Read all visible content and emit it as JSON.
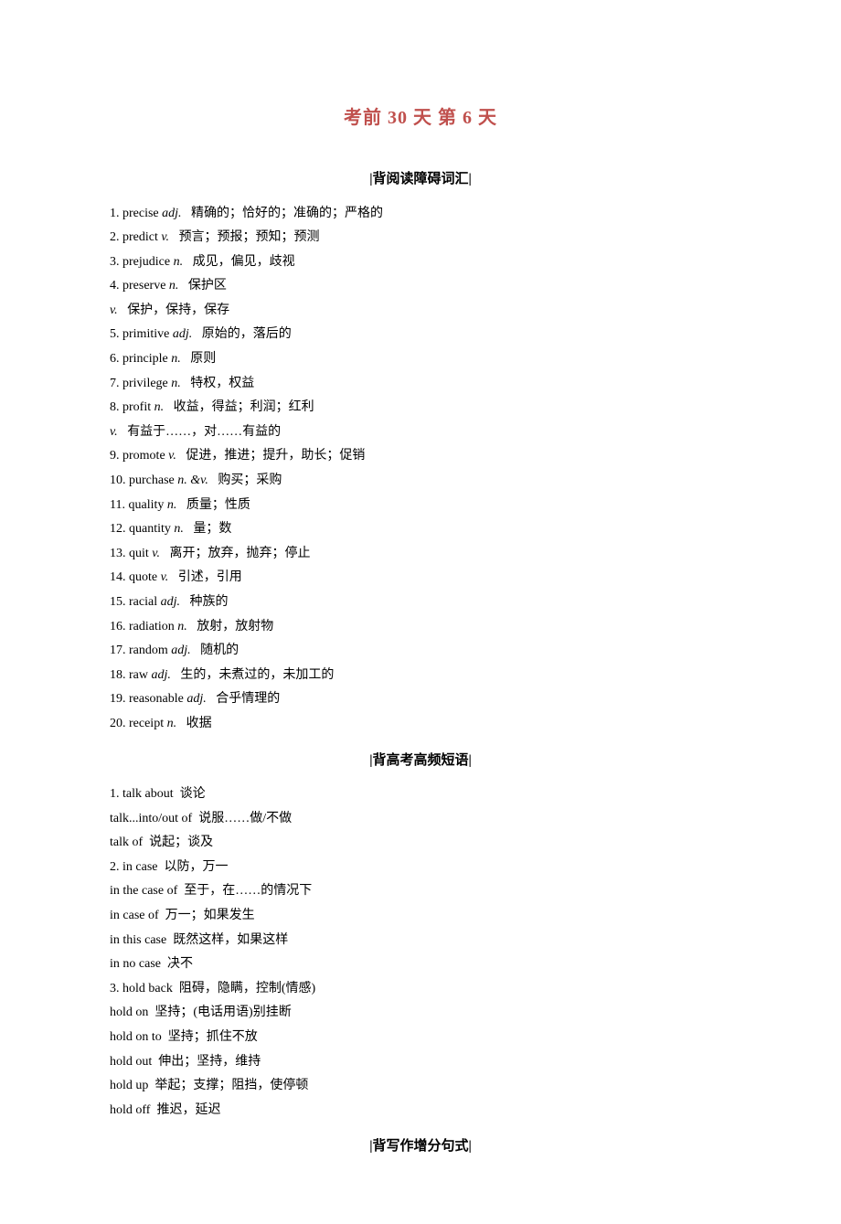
{
  "title": "考前 30 天  第 6 天",
  "sections": {
    "vocab": {
      "heading": "|背阅读障碍词汇|",
      "items": [
        {
          "num": "1.",
          "word": "precise",
          "pos": "adj.",
          "def": "精确的；恰好的；准确的；严格的"
        },
        {
          "num": "2.",
          "word": "predict",
          "pos": "v.",
          "def": "预言；预报；预知；预测"
        },
        {
          "num": "3.",
          "word": "prejudice",
          "pos": "n.",
          "def": "成见，偏见，歧视"
        },
        {
          "num": "4.",
          "word": "preserve",
          "pos": "n.",
          "def": "保护区",
          "extra": [
            {
              "pos": "v.",
              "def": "保护，保持，保存"
            }
          ]
        },
        {
          "num": "5.",
          "word": "primitive",
          "pos": "adj.",
          "def": "原始的，落后的"
        },
        {
          "num": "6.",
          "word": "principle",
          "pos": "n.",
          "def": "原则"
        },
        {
          "num": "7.",
          "word": "privilege",
          "pos": "n.",
          "def": "特权，权益"
        },
        {
          "num": "8.",
          "word": "profit",
          "pos": "n.",
          "def": "收益，得益；利润；红利",
          "extra": [
            {
              "pos": "v.",
              "def": "有益于……，对……有益的"
            }
          ]
        },
        {
          "num": "9.",
          "word": "promote",
          "pos": "v.",
          "def": "促进，推进；提升，助长；促销"
        },
        {
          "num": "10.",
          "word": "purchase",
          "pos": "n. &v.",
          "def": "购买；采购"
        },
        {
          "num": "11.",
          "word": "quality",
          "pos": "n.",
          "def": "质量；性质"
        },
        {
          "num": "12.",
          "word": "quantity",
          "pos": "n.",
          "def": "量；数"
        },
        {
          "num": "13.",
          "word": "quit",
          "pos": "v.",
          "def": "离开；放弃，抛弃；停止"
        },
        {
          "num": "14.",
          "word": "quote",
          "pos": "v.",
          "def": "引述，引用"
        },
        {
          "num": "15.",
          "word": "racial",
          "pos": "adj.",
          "def": "种族的"
        },
        {
          "num": "16.",
          "word": "radiation",
          "pos": "n.",
          "def": "放射，放射物"
        },
        {
          "num": "17.",
          "word": "random",
          "pos": "adj.",
          "def": "随机的"
        },
        {
          "num": "18.",
          "word": "raw",
          "pos": "adj.",
          "def": "生的，未煮过的，未加工的"
        },
        {
          "num": "19.",
          "word": "reasonable",
          "pos": "adj.",
          "def": "合乎情理的"
        },
        {
          "num": "20.",
          "word": "receipt",
          "pos": "n.",
          "def": "收据"
        }
      ]
    },
    "phrases": {
      "heading": "|背高考高频短语|",
      "items": [
        {
          "num": "1.",
          "main": "talk about",
          "def": "谈论",
          "subs": [
            {
              "text": "talk...into/out of",
              "def": "说服……做/不做"
            },
            {
              "text": "talk of",
              "def": "说起；谈及"
            }
          ]
        },
        {
          "num": "2.",
          "main": "in case",
          "def": "以防，万一",
          "subs": [
            {
              "text": "in the case of",
              "def": "至于，在……的情况下"
            },
            {
              "text": "in case of",
              "def": "万一；如果发生"
            },
            {
              "text": "in this case",
              "def": "既然这样，如果这样"
            },
            {
              "text": "in no case",
              "def": "决不"
            }
          ]
        },
        {
          "num": "3.",
          "main": "hold back",
          "def": "阻碍，隐瞒，控制(情感)",
          "subs": [
            {
              "text": "hold on",
              "def": "坚持；(电话用语)别挂断"
            },
            {
              "text": "hold on to",
              "def": "坚持；抓住不放"
            },
            {
              "text": "hold out",
              "def": "伸出；坚持，维持"
            },
            {
              "text": "hold up",
              "def": "举起；支撑；阻挡，使停顿"
            },
            {
              "text": "hold off",
              "def": "推迟，延迟"
            }
          ]
        }
      ]
    },
    "writing": {
      "heading": "|背写作增分句式|"
    }
  }
}
